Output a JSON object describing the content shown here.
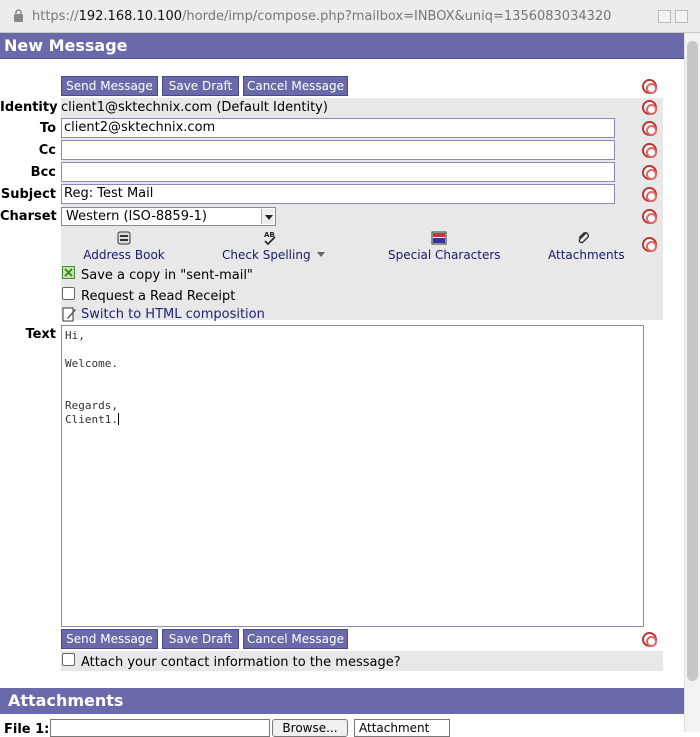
{
  "browser": {
    "url_prefix": "https://",
    "url_host": "192.168.10.100",
    "url_path": "/horde/imp/compose.php?mailbox=INBOX&uniq=1356083034320"
  },
  "header": {
    "title": "New Message"
  },
  "buttons": {
    "send": "Send Message",
    "save_draft": "Save Draft",
    "cancel": "Cancel Message"
  },
  "fields": {
    "identity_label": "Identity",
    "identity_value": "client1@sktechnix.com (Default Identity)",
    "to_label": "To",
    "to_value": "client2@sktechnix.com",
    "cc_label": "Cc",
    "cc_value": "",
    "bcc_label": "Bcc",
    "bcc_value": "",
    "subject_label": "Subject",
    "subject_value": "Reg: Test Mail",
    "charset_label": "Charset",
    "charset_value": "Western (ISO-8859-1)"
  },
  "tools": {
    "address_book": "Address Book",
    "check_spelling": "Check Spelling",
    "special_characters": "Special Characters",
    "attachments": "Attachments"
  },
  "options": {
    "save_copy": "Save a copy in \"sent-mail\"",
    "read_receipt": "Request a Read Receipt",
    "html_switch": "Switch to HTML composition",
    "attach_contact": "Attach your contact information to the message?"
  },
  "body": {
    "label": "Text",
    "lines": [
      "Hi,",
      "",
      "Welcome.",
      "",
      "",
      "Regards,",
      "Client1."
    ]
  },
  "attachments": {
    "title": "Attachments",
    "file_label": "File 1:",
    "browse_label": "Browse...",
    "disposition": "Attachment"
  },
  "colors": {
    "accent": "#6a6aab",
    "panel": "#e8e8e8",
    "help_icon": "#b33333"
  }
}
